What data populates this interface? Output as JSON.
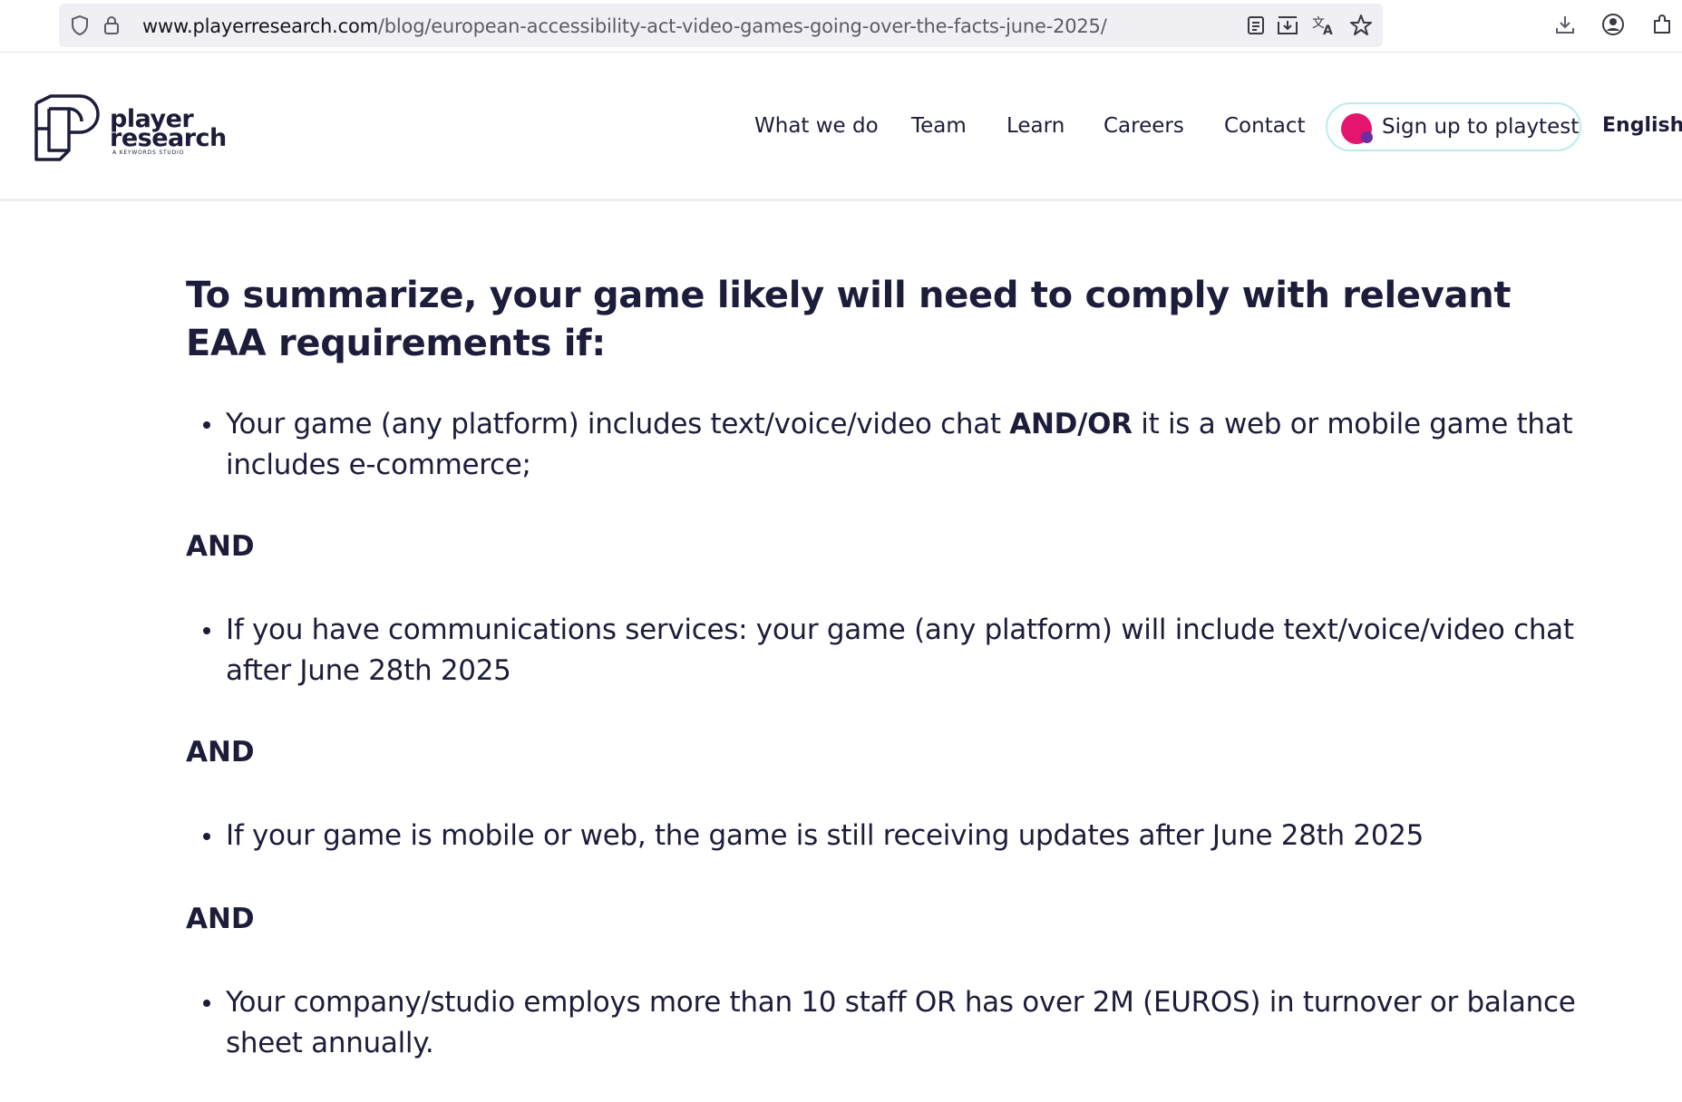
{
  "browser": {
    "url_host": "www.playerresearch.com",
    "url_path": "/blog/european-accessibility-act-video-games-going-over-the-facts-june-2025/",
    "icons": [
      "shield-icon",
      "lock-icon",
      "reader-view-icon",
      "save-page-icon",
      "translate-icon",
      "bookmark-star-icon",
      "downloads-icon",
      "account-icon",
      "extensions-icon"
    ]
  },
  "header": {
    "logo_line1": "player",
    "logo_line2": "research",
    "logo_sub": "A KEYWORDS STUDIO",
    "nav": [
      "What we do",
      "Team",
      "Learn",
      "Careers",
      "Contact"
    ],
    "playtest_label": "Sign up to playtest",
    "language": "English /"
  },
  "content": {
    "heading": "To summarize, your game likely will need to comply with relevant EAA requirements if:",
    "bullet1_part1": "Your game (any platform) includes text/voice/video chat ",
    "bullet1_bold": "AND/OR",
    "bullet1_part2": " it is a web or mobile game that includes e-commerce;",
    "and_label": "AND",
    "bullet2": "If you have communications services: your game (any platform) will include text/voice/video chat after June 28th 2025",
    "bullet3": "If your game is mobile or web, the game is still receiving updates after June 28th 2025",
    "bullet4": "Your company/studio employs more than 10 staff OR has over 2M (EUROS) in turnover or balance sheet annually."
  },
  "colors": {
    "text": "#1c1d3a",
    "playtest_border": "#b9ece9",
    "playtest_dot": "#e5156f",
    "playtest_dot_accent": "#6b2e9e"
  }
}
